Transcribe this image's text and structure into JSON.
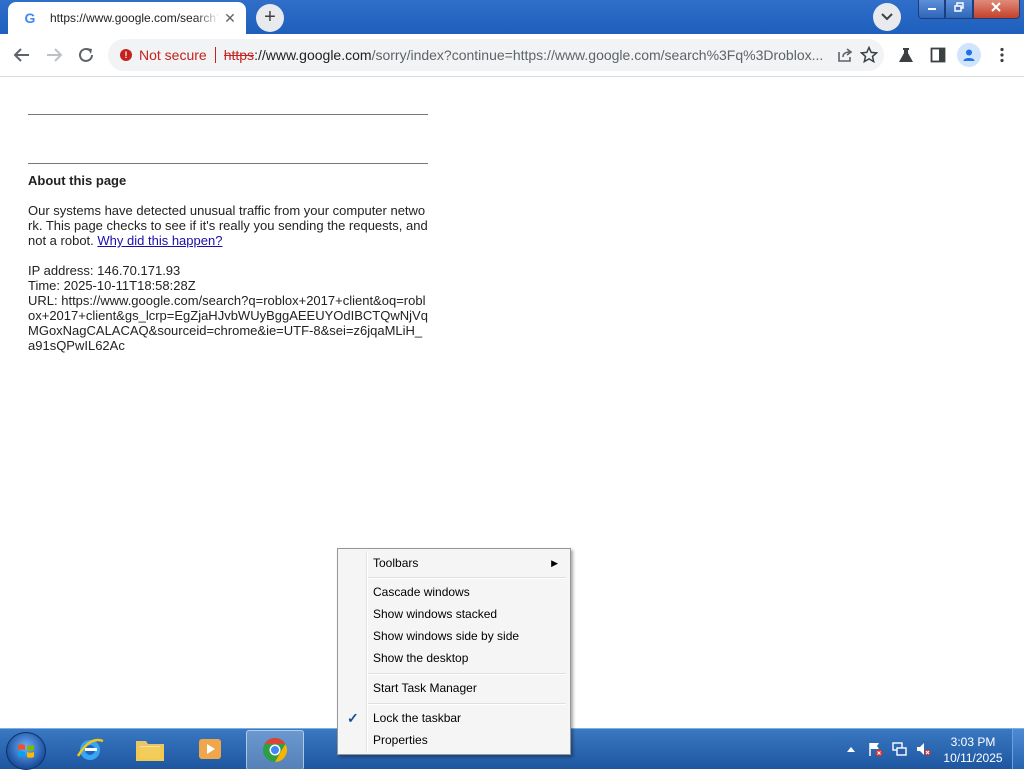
{
  "browser": {
    "tab": {
      "favicon": "G",
      "title": "https://www.google.com/search?q=roblox",
      "close": "✕"
    },
    "new_tab": "+",
    "security_label": "Not secure",
    "url": {
      "scheme": "https",
      "host": "://www.google.com",
      "rest": "/sorry/index?continue=https://www.google.com/search%3Fq%3Droblox..."
    }
  },
  "page": {
    "about_heading": "About this page",
    "message": "Our systems have detected unusual traffic from your computer network. This page checks to see if it's really you sending the requests, and not a robot.",
    "why_link": "Why did this happen?",
    "ip_line": "IP address: 146.70.171.93",
    "time_line": "Time: 2025-10-11T18:58:28Z",
    "url_line": "URL: https://www.google.com/search?q=roblox+2017+client&oq=roblox+2017+client&gs_lcrp=EgZjaHJvbWUyBggAEEUYOdIBCTQwNjVqMGoxNagCALACAQ&sourceid=chrome&ie=UTF-8&sei=z6jqaMLiH_a91sQPwIL62Ac"
  },
  "context_menu": {
    "toolbars": "Toolbars",
    "cascade": "Cascade windows",
    "stacked": "Show windows stacked",
    "side_by_side": "Show windows side by side",
    "show_desktop": "Show the desktop",
    "task_manager": "Start Task Manager",
    "lock_taskbar": "Lock the taskbar",
    "lock_taskbar_checked": true,
    "properties": "Properties"
  },
  "taskbar": {
    "clock_time": "3:03 PM",
    "clock_date": "10/11/2025",
    "apps": [
      "internet-explorer-icon",
      "file-explorer-icon",
      "media-player-icon",
      "chrome-icon"
    ]
  },
  "colors": {
    "titlebar": "#2f6fc9",
    "insecure_red": "#c5221f",
    "link_blue": "#1a0dab",
    "taskbar": "#1e56a0"
  }
}
